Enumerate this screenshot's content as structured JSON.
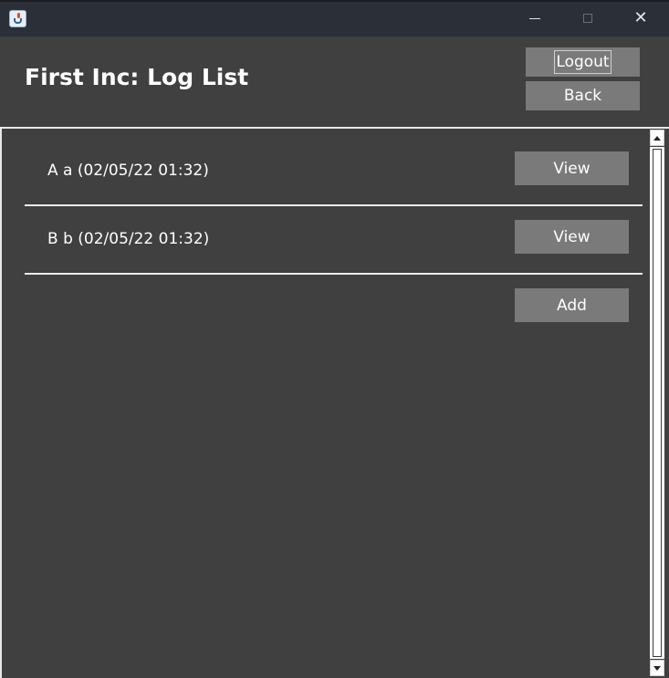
{
  "window": {
    "icon": "java-cup-icon",
    "controls": [
      "minimize-icon",
      "maximize-icon",
      "close-icon"
    ],
    "close_glyph": "✕"
  },
  "header": {
    "title": "First Inc: Log List",
    "logout_label": "Logout",
    "back_label": "Back"
  },
  "logs": {
    "items": [
      {
        "label": "A a (02/05/22 01:32)",
        "button": "View"
      },
      {
        "label": "B b (02/05/22 01:32)",
        "button": "View"
      }
    ],
    "add_label": "Add"
  },
  "colors": {
    "background": "#404040",
    "titlebar": "#2b2f38",
    "button": "#7a7a7a",
    "text": "#ffffff"
  }
}
